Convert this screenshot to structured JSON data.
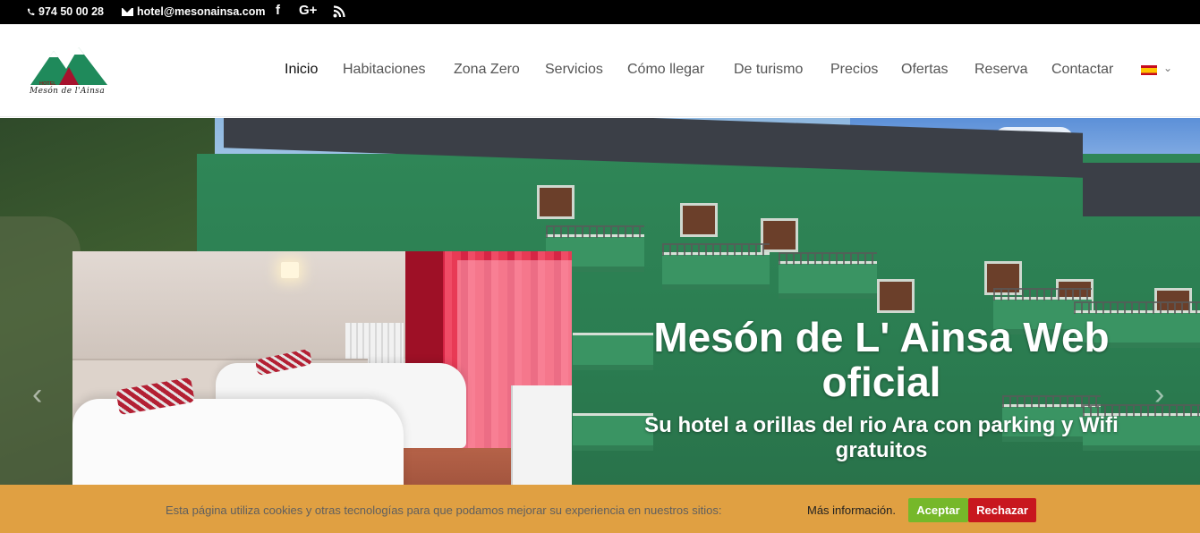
{
  "topbar": {
    "phone": "974 50 00 28",
    "email": "hotel@mesonainsa.com",
    "social": [
      "f",
      "G+",
      "rss"
    ]
  },
  "logo": {
    "small_text": "HOTEL",
    "name": "Mesón de l'Ainsa"
  },
  "nav": {
    "items": [
      "Inicio",
      "Habitaciones",
      "Zona Zero",
      "Servicios",
      "Cómo llegar",
      "De turismo",
      "Precios",
      "Ofertas",
      "Reserva",
      "Contactar"
    ],
    "active": "Inicio",
    "language_caret": "⌄"
  },
  "hero": {
    "title": "Mesón de L' Ainsa Web oficial",
    "subtitle": "Su hotel a orillas del rio Ara con parking y Wifi gratuitos",
    "prev_arrow": "‹",
    "next_arrow": "›"
  },
  "cookie": {
    "message": "Esta página utiliza cookies y otras tecnologías para que podamos mejorar su experiencia en nuestros sitios:",
    "more_info": "Más información.",
    "accept": "Aceptar",
    "reject": "Rechazar"
  },
  "colors": {
    "topbar_bg": "#000000",
    "cookie_bg": "#e0a042",
    "accept_bg": "#76b82a",
    "reject_bg": "#c8171e",
    "logo_green": "#1f8a5b"
  }
}
